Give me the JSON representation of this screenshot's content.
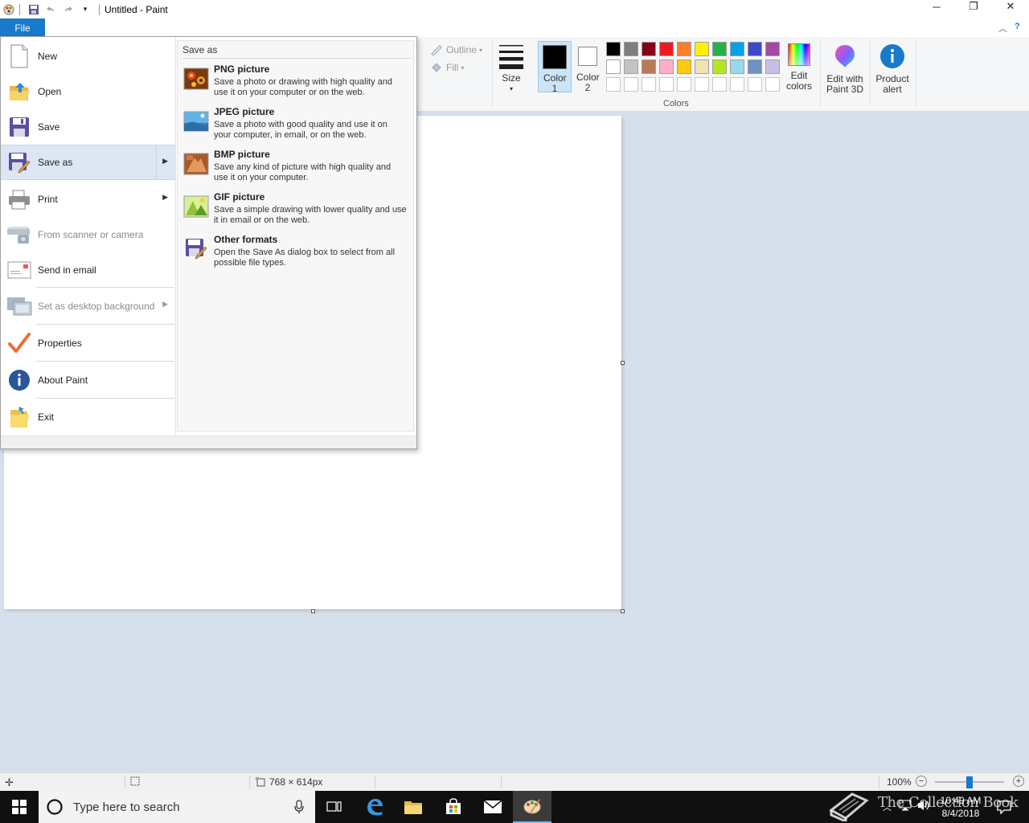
{
  "window": {
    "title": "Untitled - Paint",
    "controls": {
      "minimize": "─",
      "restore": "❐",
      "close": "✕"
    }
  },
  "ribbon": {
    "file_tab": "File",
    "outline_label": "Outline",
    "fill_label": "Fill",
    "size_label": "Size",
    "color1_label": "Color 1",
    "color2_label": "Color 2",
    "edit_colors_label": "Edit colors",
    "paint3d_label": "Edit with Paint 3D",
    "product_alert_label": "Product alert",
    "colors_group_label": "Colors",
    "palette_row1": [
      "#000000",
      "#7f7f7f",
      "#880015",
      "#ed1c24",
      "#ff7f27",
      "#fff200",
      "#22b14c",
      "#00a2e8",
      "#3f48cc",
      "#a349a4"
    ],
    "palette_row2": [
      "#ffffff",
      "#c3c3c3",
      "#b97a57",
      "#ffaec9",
      "#ffc90e",
      "#efe4b0",
      "#b5e61d",
      "#99d9ea",
      "#7092be",
      "#c8bfe7"
    ],
    "palette_row3": [
      "#ffffff",
      "#ffffff",
      "#ffffff",
      "#ffffff",
      "#ffffff",
      "#ffffff",
      "#ffffff",
      "#ffffff",
      "#ffffff",
      "#ffffff"
    ],
    "color1_value": "#000000",
    "color2_value": "#ffffff"
  },
  "file_menu": {
    "items": [
      {
        "label": "New",
        "icon": "new-file-icon",
        "enabled": true
      },
      {
        "label": "Open",
        "icon": "open-folder-icon",
        "enabled": true
      },
      {
        "label": "Save",
        "icon": "save-disk-icon",
        "enabled": true
      },
      {
        "label": "Save as",
        "icon": "save-as-icon",
        "enabled": true,
        "submenu": true,
        "selected": true
      },
      {
        "label": "Print",
        "icon": "printer-icon",
        "enabled": true,
        "submenu": true
      },
      {
        "label": "From scanner or camera",
        "icon": "scanner-icon",
        "enabled": false
      },
      {
        "label": "Send in email",
        "icon": "email-icon",
        "enabled": true
      },
      {
        "label": "Set as desktop background",
        "icon": "desktop-icon",
        "enabled": false,
        "submenu": true
      },
      {
        "label": "Properties",
        "icon": "checkmark-icon",
        "enabled": true
      },
      {
        "label": "About Paint",
        "icon": "info-icon",
        "enabled": true
      },
      {
        "label": "Exit",
        "icon": "exit-icon",
        "enabled": true
      }
    ],
    "save_as": {
      "header": "Save as",
      "options": [
        {
          "title": "PNG picture",
          "desc": "Save a photo or drawing with high quality and use it on your computer or on the web.",
          "icon": "png-image-icon"
        },
        {
          "title": "JPEG picture",
          "desc": "Save a photo with good quality and use it on your computer, in email, or on the web.",
          "icon": "jpeg-image-icon"
        },
        {
          "title": "BMP picture",
          "desc": "Save any kind of picture with high quality and use it on your computer.",
          "icon": "bmp-image-icon"
        },
        {
          "title": "GIF picture",
          "desc": "Save a simple drawing with lower quality and use it in email or on the web.",
          "icon": "gif-image-icon"
        },
        {
          "title": "Other formats",
          "desc": "Open the Save As dialog box to select from all possible file types.",
          "icon": "other-formats-icon"
        }
      ]
    }
  },
  "statusbar": {
    "image_size": "768 × 614px",
    "zoom": "100%",
    "zoom_out": "−",
    "zoom_in": "+"
  },
  "taskbar": {
    "search_placeholder": "Type here to search",
    "time": "10:49 AM",
    "date": "8/4/2018",
    "watermark": "The Collection Book"
  }
}
